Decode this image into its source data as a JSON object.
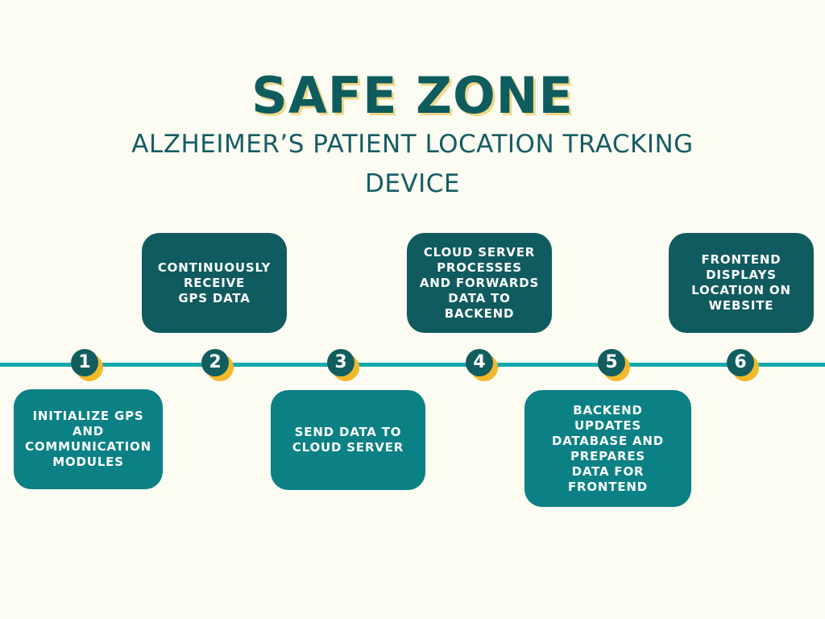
{
  "header": {
    "title": "SAFE ZONE",
    "subtitle": "ALZHEIMER’S PATIENT LOCATION TRACKING DEVICE"
  },
  "steps": [
    {
      "number": "1",
      "text": "INITIALIZE GPS AND\nCOMMUNICATION\nMODULES"
    },
    {
      "number": "2",
      "text": "CONTINUOUSLY\nRECEIVE\nGPS DATA"
    },
    {
      "number": "3",
      "text": "SEND DATA TO\nCLOUD SERVER"
    },
    {
      "number": "4",
      "text": "CLOUD SERVER\nPROCESSES\nAND FORWARDS\nDATA TO\nBACKEND"
    },
    {
      "number": "5",
      "text": "BACKEND\nUPDATES\nDATABASE AND\nPREPARES\nDATA FOR\nFRONTEND"
    },
    {
      "number": "6",
      "text": "FRONTEND\nDISPLAYS\nLOCATION ON\nWEBSITE"
    }
  ],
  "colors": {
    "background": "#fdfcf3",
    "primary_dark": "#105b5f",
    "primary_light": "#0b8185",
    "timeline": "#14a9ad",
    "accent": "#f1b92b"
  }
}
